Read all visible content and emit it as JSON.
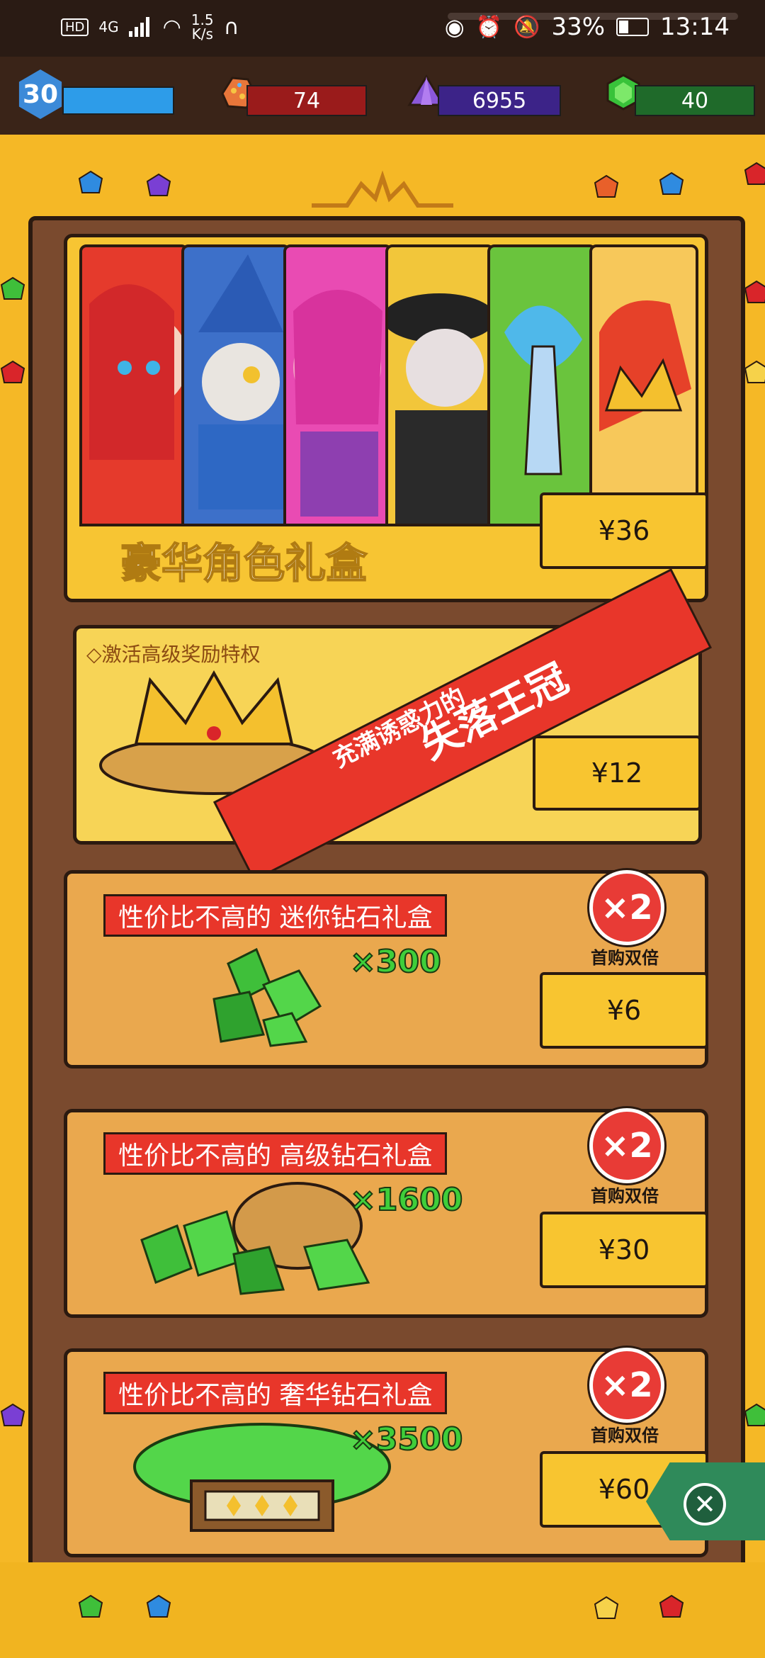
{
  "status_bar": {
    "hd": "HD",
    "network": "4G",
    "speed_value": "1.5",
    "speed_unit": "K/s",
    "battery": "33%",
    "time": "13:14"
  },
  "resources": {
    "level": "30",
    "ore": "74",
    "crystal": "6955",
    "gem": "40"
  },
  "cards": {
    "character_box": {
      "title": "豪华角色礼盒",
      "price": "¥36"
    },
    "crown": {
      "privilege": "◇激活高级奖励特权",
      "banner_small": "充满诱惑力的",
      "banner_big": "失落王冠",
      "price": "¥12"
    },
    "mini": {
      "title": "性价比不高的 迷你钻石礼盒",
      "qty": "×300",
      "badge": "×2",
      "badge_caption": "首购双倍",
      "price": "¥6"
    },
    "advanced": {
      "title": "性价比不高的 高级钻石礼盒",
      "qty": "×1600",
      "badge": "×2",
      "badge_caption": "首购双倍",
      "price": "¥30"
    },
    "luxury": {
      "title": "性价比不高的 奢华钻石礼盒",
      "qty": "×3500",
      "badge": "×2",
      "badge_caption": "首购双倍",
      "price": "¥60"
    }
  },
  "colors": {
    "panel": "#f5b826",
    "frame": "#7a4a2e",
    "ribbon": "#e8362a",
    "gem_green": "#3fce3a",
    "level_blue": "#2d9ce9",
    "ore_red": "#9a1b1b",
    "crystal_purple": "#3c2388",
    "gem_green_bar": "#1f6a2a"
  }
}
